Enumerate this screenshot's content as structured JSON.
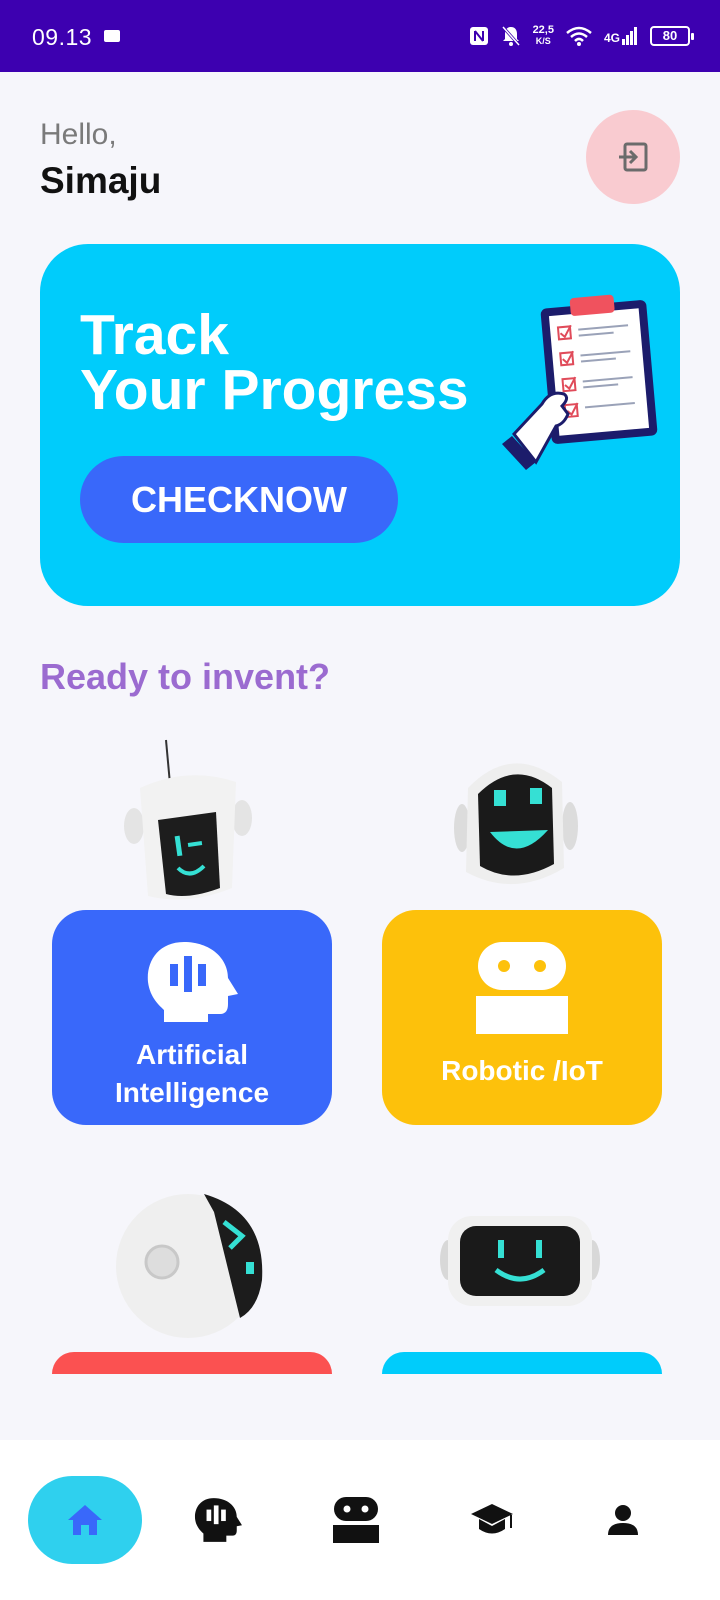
{
  "status_bar": {
    "time": "09.13",
    "speed_value": "22,5",
    "speed_unit": "K/S",
    "network": "4G",
    "battery": "80"
  },
  "greeting": {
    "hello": "Hello,",
    "name": "Simaju"
  },
  "progress_card": {
    "title": "Track\nYour Progress",
    "button": "CHECKNOW"
  },
  "section_title": "Ready to invent?",
  "categories": [
    {
      "label": "Artificial\nIntelligence",
      "color": "#3968fa",
      "icon": "head-bars-icon"
    },
    {
      "label": "Robotic /IoT",
      "color": "#fdc10b",
      "icon": "robot-icon"
    },
    {
      "label": "",
      "color": "#fb5151",
      "icon": ""
    },
    {
      "label": "",
      "color": "#00ccfb",
      "icon": ""
    }
  ],
  "bottom_nav": {
    "items": [
      "home-icon",
      "head-bars-icon",
      "robot-icon",
      "graduation-cap-icon",
      "user-icon"
    ],
    "active": "home-icon",
    "active_color": "#2fd0ee",
    "icon_color": "#111111",
    "active_icon_color": "#3968fa"
  }
}
